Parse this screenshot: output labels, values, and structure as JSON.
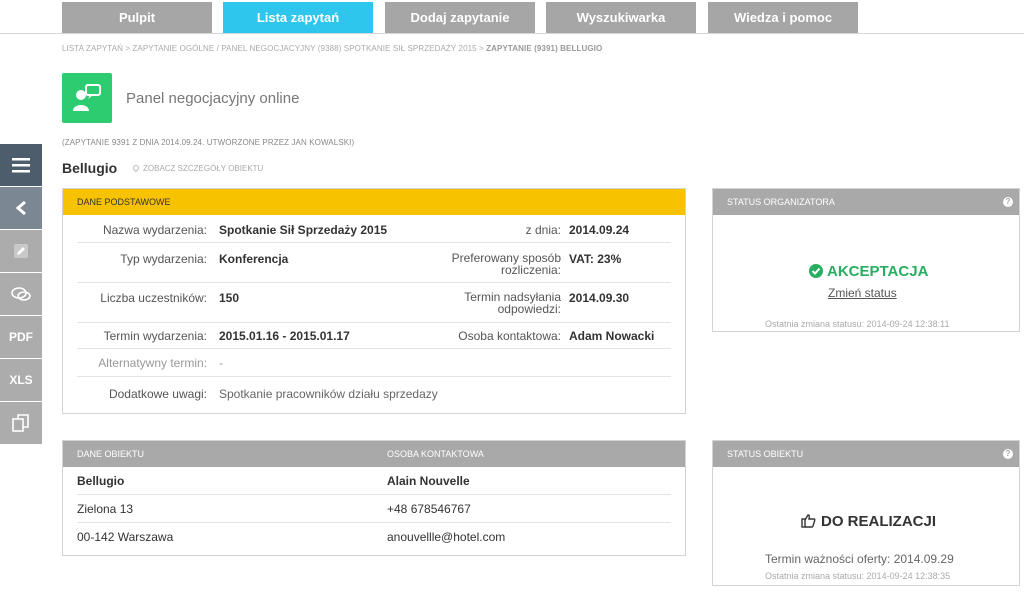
{
  "nav": {
    "tabs": [
      {
        "label": "Pulpit"
      },
      {
        "label": "Lista zapytań"
      },
      {
        "label": "Dodaj zapytanie"
      },
      {
        "label": "Wyszukiwarka"
      },
      {
        "label": "Wiedza i pomoc"
      }
    ]
  },
  "breadcrumb": {
    "path": "LISTA ZAPYTAŃ > ZAPYTANIE OGÓLNE / PANEL NEGOCJACYJNY (9388) SPOTKANIE SIŁ SPRZEDAŻY 2015 > ",
    "current": "ZAPYTANIE (9391) BELLUGIO"
  },
  "page": {
    "title": "Panel negocjacyjny online",
    "subinfo": "(ZAPYTANIE 9391 Z DNIA 2014.09.24. UTWORZONE PRZEZ JAN KOWALSKI)",
    "hotel_name": "Bellugio",
    "see_details": "ZOBACZ SZCZEGÓŁY OBIEKTU"
  },
  "sidebar": {
    "items": [
      {
        "icon": "menu-icon"
      },
      {
        "icon": "chevron-left-icon"
      },
      {
        "icon": "pencil-icon"
      },
      {
        "icon": "chat-icon"
      },
      {
        "label": "PDF"
      },
      {
        "label": "XLS"
      },
      {
        "icon": "copy-icon"
      }
    ]
  },
  "basic": {
    "header": "DANE PODSTAWOWE",
    "event_name_label": "Nazwa wydarzenia:",
    "event_name": "Spotkanie Sił Sprzedaży 2015",
    "date_label": "z dnia:",
    "date": "2014.09.24",
    "event_type_label": "Typ wydarzenia:",
    "event_type": "Konferencja",
    "settlement_label_1": "Preferowany sposób",
    "settlement_label_2": "rozliczenia:",
    "settlement": "VAT: 23%",
    "participants_label": "Liczba uczestników:",
    "participants": "150",
    "deadline_label_1": "Termin nadsyłania",
    "deadline_label_2": "odpowiedzi:",
    "deadline": "2014.09.30",
    "event_term_label": "Termin wydarzenia:",
    "event_term": "2015.01.16 - 2015.01.17",
    "contact_label": "Osoba kontaktowa:",
    "contact": "Adam Nowacki",
    "alt_term_label": "Alternatywny termin:",
    "alt_term": "-",
    "notes_label": "Dodatkowe uwagi:",
    "notes": "Spotkanie pracowników działu sprzedazy"
  },
  "organizer_status": {
    "header": "STATUS ORGANIZATORA",
    "help": "?",
    "status": "AKCEPTACJA",
    "change_link": "Zmień status",
    "last_change": "Ostatnia zmiana statusu: 2014-09-24 12:38:11"
  },
  "object": {
    "header_left": "DANE OBIEKTU",
    "header_right": "OSOBA KONTAKTOWA",
    "name": "Bellugio",
    "street": "Zielona 13",
    "city": "00-142 Warszawa",
    "contact_name": "Alain Nouvelle",
    "phone": "+48 678546767",
    "email": "anouvellle@hotel.com"
  },
  "object_status": {
    "header": "STATUS OBIEKTU",
    "help": "?",
    "status": "DO REALIZACJI",
    "validity": "Termin ważności oferty: 2014.09.29",
    "last_change": "Ostatnia zmiana statusu: 2014-09-24 12:38:35"
  },
  "colors": {
    "accent": "#2fc6ee",
    "tab_gray": "#a6a6a6",
    "yellow": "#f7c200",
    "green": "#27ae60",
    "sidebar_dark": "#4e5d6c"
  }
}
